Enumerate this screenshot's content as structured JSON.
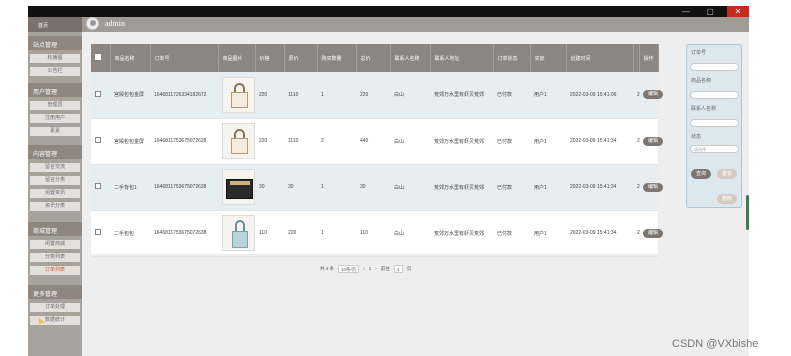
{
  "window": {
    "minimize": "—",
    "maximize": "▢",
    "close": "✕"
  },
  "header": {
    "user": "admin"
  },
  "sidebar": {
    "home": "首页",
    "sections": [
      {
        "title": "站点管理",
        "items": [
          "轮播图",
          "公告栏"
        ]
      },
      {
        "title": "用户管理",
        "items": [
          "管理员",
          "注册用户",
          "素素"
        ]
      },
      {
        "title": "内容管理",
        "items": [
          "留言交流",
          "留言分类",
          "闲置资讯",
          "资讯分类"
        ]
      },
      {
        "title": "商城管理",
        "items": [
          "闲置商城",
          "分类列表",
          "订单列表"
        ]
      },
      {
        "title": "更多管理",
        "items": [
          "订单处理",
          "数据统计"
        ]
      }
    ]
  },
  "table": {
    "headers": [
      "",
      "商品名称",
      "订单号",
      "商品图片",
      "价格",
      "原价",
      "购买数量",
      "总价",
      "联系人名称",
      "联系人地址",
      "订单状态",
      "买家",
      "创建时间",
      "",
      "操作"
    ],
    "rows": [
      {
        "name": "宫殿包包金屏",
        "order": "1646811726334182672",
        "img": "bag-a",
        "price": "220",
        "orig": "1110",
        "qty": "1",
        "total": "220",
        "contact": "白山",
        "addr": "荒郊万水里有虾贝荒郊",
        "status": "已付款",
        "buyer": "用户1",
        "time": "2022-03-09 15:41:06",
        "n": "2"
      },
      {
        "name": "宫殿包包金屏",
        "order": "1646811753675072638",
        "img": "bag-a",
        "price": "220",
        "orig": "1110",
        "qty": "2",
        "total": "440",
        "contact": "白山",
        "addr": "荒郊万水里有虾贝荒郊",
        "status": "已付款",
        "buyer": "用户1",
        "time": "2022-03-09 15:41:34",
        "n": "2"
      },
      {
        "name": "二手背包1",
        "order": "1646811753675072638",
        "img": "bag-b",
        "price": "30",
        "orig": "30",
        "qty": "1",
        "total": "30",
        "contact": "白山",
        "addr": "荒郊万水里有虾贝荒郊",
        "status": "已付款",
        "buyer": "用户1",
        "time": "2022-03-09 15:41:34",
        "n": "2"
      },
      {
        "name": "二手包包",
        "order": "1646811753675072638",
        "img": "bag-c",
        "price": "110",
        "orig": "220",
        "qty": "1",
        "total": "110",
        "contact": "白山",
        "addr": "荒郊万水里有虾贝荒郊",
        "status": "已付款",
        "buyer": "用户1",
        "time": "2022-03-09 15:41:34",
        "n": "2"
      }
    ],
    "edit_label": "编辑"
  },
  "pagination": {
    "total": "共 4 条",
    "per_page": "10条/页",
    "prev": "‹",
    "page": "1",
    "next": "›",
    "goto": "前往",
    "goto_page": "1",
    "unit": "页"
  },
  "filter": {
    "order_label": "订单号",
    "product_label": "商品名称",
    "contact_label": "联系人名称",
    "status_label": "状态",
    "status_placeholder": "请选择",
    "search_btn": "查询",
    "reset_btn": "重置",
    "delete_btn": "删除"
  },
  "watermark": "CSDN @VXbishe"
}
